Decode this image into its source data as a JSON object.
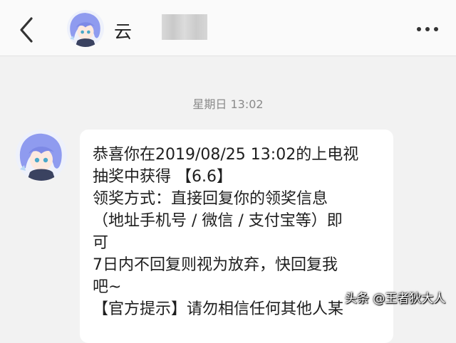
{
  "header": {
    "back_icon": "chevron-left-icon",
    "contact_name": "云",
    "more_icon": "more-horizontal-icon"
  },
  "chat": {
    "timestamp": "星期日 13:02",
    "message": {
      "lines": [
        "恭喜你在2019/08/25 13:02的上电视",
        "抽奖中获得 【6.6】",
        "领奖方式：直接回复你的领奖信息",
        "（地址手机号 / 微信 / 支付宝等）即",
        "可",
        "7日内不回复则视为放弃，快回复我",
        "吧~",
        "【官方提示】请勿相信任何其他人某"
      ]
    }
  },
  "watermark": "头条 @王者狄大人",
  "colors": {
    "background": "#f2f2f2",
    "header": "#fafafa",
    "bubble": "#ffffff",
    "avatar_hair": "#8f9bef"
  }
}
